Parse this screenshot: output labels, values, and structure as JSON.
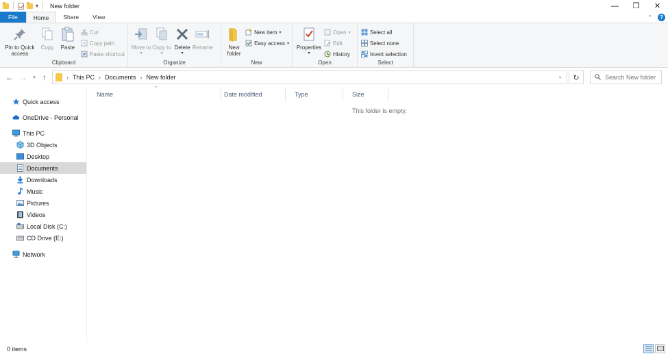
{
  "window": {
    "title": "New folder",
    "minimize_glyph": "—",
    "maximize_glyph": "❐",
    "close_glyph": "✕"
  },
  "ribbon_tabs": [
    {
      "label": "File"
    },
    {
      "label": "Home"
    },
    {
      "label": "Share"
    },
    {
      "label": "View"
    }
  ],
  "ribbon": {
    "clipboard": {
      "label": "Clipboard",
      "pin_label": "Pin to Quick access",
      "copy_label": "Copy",
      "paste_label": "Paste",
      "cut_label": "Cut",
      "copy_path_label": "Copy path",
      "paste_shortcut_label": "Paste shortcut"
    },
    "organize": {
      "label": "Organize",
      "move_to_label": "Move to",
      "copy_to_label": "Copy to",
      "delete_label": "Delete",
      "rename_label": "Rename"
    },
    "new": {
      "label": "New",
      "new_folder_label": "New folder",
      "new_item_label": "New item",
      "easy_access_label": "Easy access"
    },
    "open": {
      "label": "Open",
      "properties_label": "Properties",
      "open_label": "Open",
      "edit_label": "Edit",
      "history_label": "History"
    },
    "select": {
      "label": "Select",
      "select_all_label": "Select all",
      "select_none_label": "Select none",
      "invert_label": "Invert selection"
    }
  },
  "address": {
    "breadcrumbs": [
      "This PC",
      "Documents",
      "New folder"
    ],
    "search_placeholder": "Search New folder"
  },
  "nav_pane": {
    "items": [
      {
        "label": "Quick access",
        "icon": "star-icon"
      },
      {
        "label": "OneDrive - Personal",
        "icon": "cloud-icon"
      },
      {
        "label": "This PC",
        "icon": "computer-icon"
      },
      {
        "label": "3D Objects",
        "icon": "cube-icon"
      },
      {
        "label": "Desktop",
        "icon": "desktop-icon"
      },
      {
        "label": "Documents",
        "icon": "document-icon"
      },
      {
        "label": "Downloads",
        "icon": "download-icon"
      },
      {
        "label": "Music",
        "icon": "music-icon"
      },
      {
        "label": "Pictures",
        "icon": "picture-icon"
      },
      {
        "label": "Videos",
        "icon": "video-icon"
      },
      {
        "label": "Local Disk (C:)",
        "icon": "disk-icon"
      },
      {
        "label": "CD Drive (E:)",
        "icon": "cd-drive-icon"
      },
      {
        "label": "Network",
        "icon": "network-icon"
      }
    ],
    "selected": "Documents"
  },
  "file_list": {
    "columns": [
      "Name",
      "Date modified",
      "Type",
      "Size"
    ],
    "empty_message": "This folder is empty."
  },
  "status": {
    "item_count": "0 items"
  },
  "colors": {
    "accent": "#1979ca",
    "ribbon_bg": "#f5f6f7",
    "selected_nav": "#d9d9d9",
    "folder_yellow": "#f4c94a"
  }
}
